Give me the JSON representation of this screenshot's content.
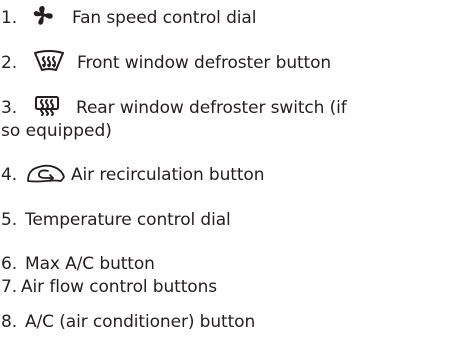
{
  "items": [
    {
      "number": "1.",
      "icon": "fan-icon",
      "text": "Fan speed control dial"
    },
    {
      "number": "2.",
      "icon": "front-defroster-icon",
      "text": "Front window defroster button"
    },
    {
      "number": "3.",
      "icon": "rear-defroster-icon",
      "text": "Rear window defroster switch (if",
      "continuation": "so equipped)"
    },
    {
      "number": "4.",
      "icon": "air-recirculation-icon",
      "text": "Air recirculation button"
    },
    {
      "number": "5.",
      "icon": null,
      "text": "Temperature control dial"
    },
    {
      "number": "6.",
      "icon": null,
      "text": "Max A/C button"
    },
    {
      "number": "7.",
      "icon": null,
      "text": "Air flow control buttons"
    },
    {
      "number": "8.",
      "icon": null,
      "text": "A/C (air conditioner) button"
    }
  ],
  "colors": {
    "text": "#231f20",
    "background": "#ffffff"
  }
}
